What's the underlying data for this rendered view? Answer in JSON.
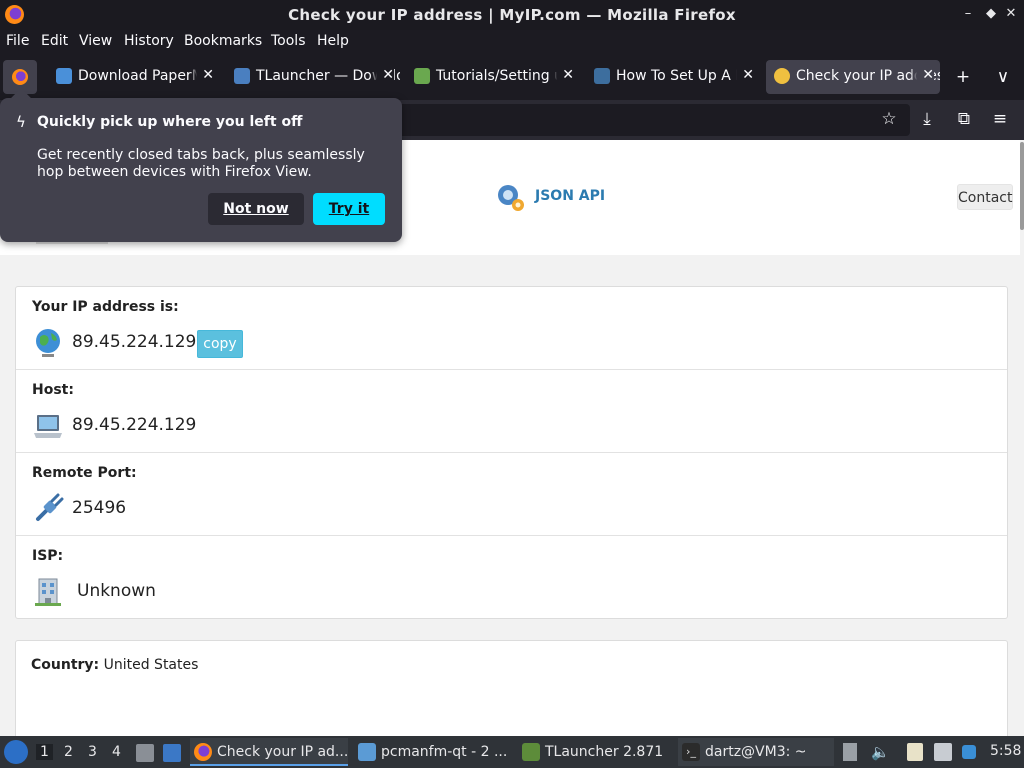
{
  "window": {
    "title": "Check your IP address | MyIP.com — Mozilla Firefox",
    "controls": [
      "–",
      "✕",
      "◆"
    ]
  },
  "menubar": {
    "items": [
      {
        "label": "File"
      },
      {
        "label": "Edit"
      },
      {
        "label": "View"
      },
      {
        "label": "History"
      },
      {
        "label": "Bookmarks"
      },
      {
        "label": "Tools"
      },
      {
        "label": "Help"
      }
    ]
  },
  "tabs": [
    {
      "label": "Download PaperMC",
      "icon": "cube-icon",
      "color": "#4a90d9"
    },
    {
      "label": "TLauncher — Download",
      "icon": "tlauncher-icon",
      "color": "#4a7fc0"
    },
    {
      "label": "Tutorials/Setting up",
      "icon": "cube-icon",
      "color": "#6aa84f"
    },
    {
      "label": "How To Set Up A Pi",
      "icon": "site-icon",
      "color": "#3d6e9e"
    },
    {
      "label": "Check your IP address",
      "icon": "smiley-icon",
      "color": "#f0c040",
      "active": true
    }
  ],
  "toolbar": {
    "new_tab": "+",
    "list_tabs": "∨",
    "bookmark": "☆",
    "download": "⤓",
    "extensions": "⧉",
    "menu": "≡"
  },
  "popup": {
    "title": "Quickly pick up where you left off",
    "body": "Get recently closed tabs back, plus seamlessly hop between devices with Firefox View.",
    "not_now": "Not now",
    "try_it": "Try it"
  },
  "site": {
    "json_api": "JSON API",
    "contact": "Contact",
    "rows": [
      {
        "label": "Your IP address is:",
        "value": "89.45.224.129",
        "icon": "globe-icon"
      },
      {
        "label": "Host:",
        "value": "89.45.224.129",
        "icon": "laptop-icon"
      },
      {
        "label": "Remote Port:",
        "value": "25496",
        "icon": "plug-icon"
      },
      {
        "label": "ISP:",
        "value": "Unknown",
        "icon": "building-icon"
      }
    ],
    "copy": "copy",
    "country_label": "Country:",
    "country_value": "United States"
  },
  "taskbar": {
    "workspaces": [
      "1",
      "2",
      "3",
      "4"
    ],
    "tasks": [
      {
        "label": "Check your IP ad...",
        "icon": "firefox-icon",
        "active": true
      },
      {
        "label": "pcmanfm-qt - 2 ...",
        "icon": "folder-icon"
      },
      {
        "label": "TLauncher 2.871",
        "icon": "minecraft-icon"
      },
      {
        "label": "dartz@VM3: ~",
        "icon": "terminal-icon"
      }
    ],
    "clock": "5:58"
  }
}
